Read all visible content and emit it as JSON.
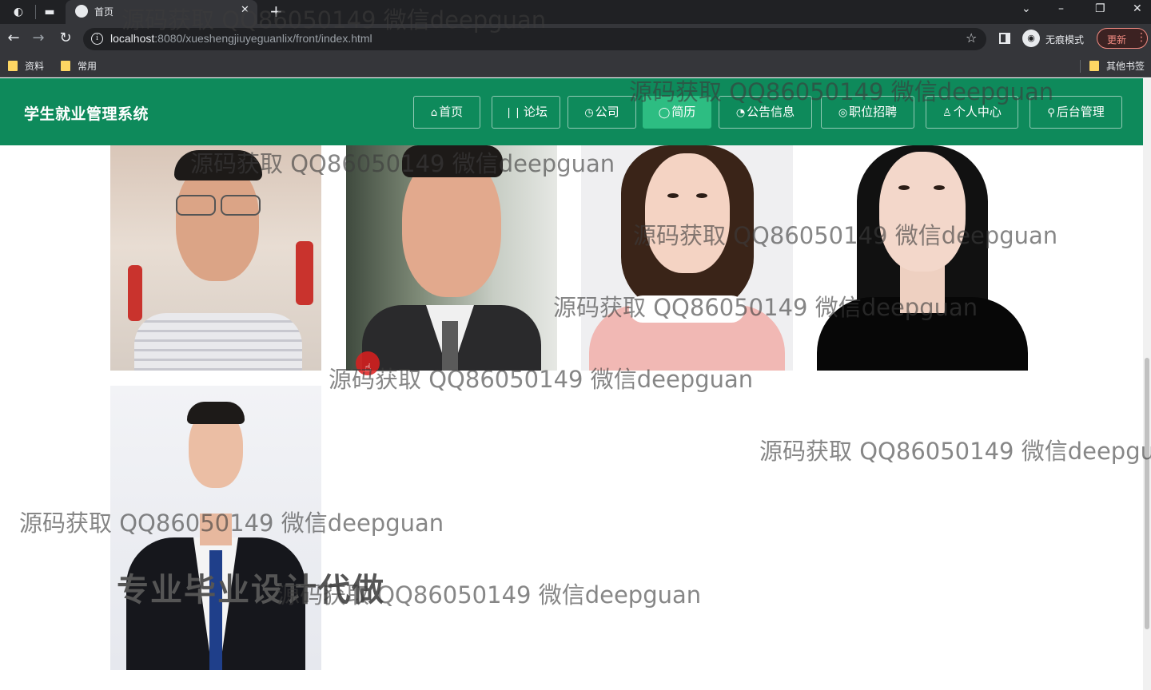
{
  "browser": {
    "tab_title": "首页",
    "url_host": "localhost",
    "url_rest": ":8080/xueshengjiuyeguanlix/front/index.html",
    "incognito_label": "无痕模式",
    "update_label": "更新",
    "bookmarks": [
      "资料",
      "常用"
    ],
    "other_bookmarks": "其他书签"
  },
  "site": {
    "title": "学生就业管理系统",
    "nav": [
      {
        "icon": "⌂",
        "label": "首页"
      },
      {
        "icon": "❘❘",
        "label": "论坛"
      },
      {
        "icon": "◷",
        "label": "公司"
      },
      {
        "icon": "◯",
        "label": "简历"
      },
      {
        "icon": "◔",
        "label": "公告信息"
      },
      {
        "icon": "◎",
        "label": "职位招聘"
      },
      {
        "icon": "♙",
        "label": "个人中心"
      },
      {
        "icon": "⚲",
        "label": "后台管理"
      }
    ],
    "active_nav": "简历"
  },
  "overlay_text": "专业毕业设计代做",
  "watermarks": [
    "源码获取 QQ86050149 微信deepguan",
    "源码获取 QQ86050149 微信deepguan",
    "源码获取 QQ86050149 微信deepguan",
    "源码获取 QQ86050149 微信deepguan",
    "源码获取 QQ86050149 微信deepguan",
    "源码获取 QQ86050149 微信deepguan",
    "源码获取 QQ86050149 微信deepgu",
    "源码获取 QQ86050149 微信deepguan",
    "源码获取 QQ86050149 微信deepguan"
  ],
  "colors": {
    "header_green": "#0e8a5b",
    "active_green": "#2dbd82"
  }
}
